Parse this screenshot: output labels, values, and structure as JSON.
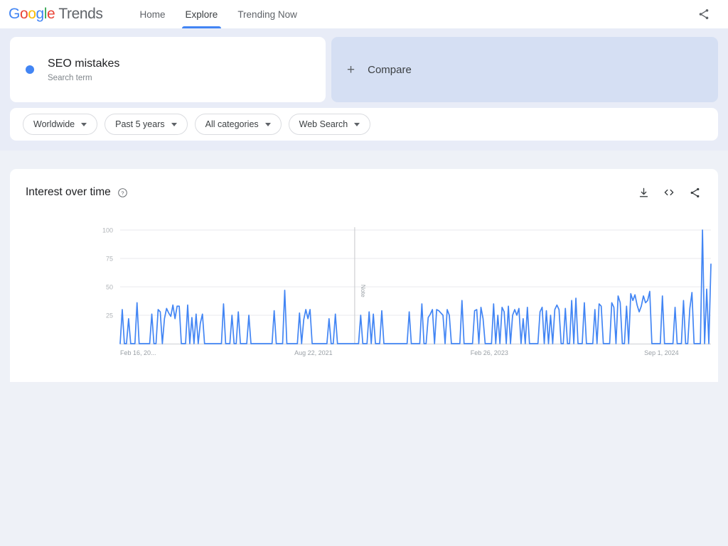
{
  "topbar": {
    "logo": {
      "google": "Google",
      "trends": "Trends"
    },
    "nav": [
      {
        "label": "Home",
        "active": false,
        "name": "nav-home"
      },
      {
        "label": "Explore",
        "active": true,
        "name": "nav-explore"
      },
      {
        "label": "Trending Now",
        "active": false,
        "name": "nav-trending-now"
      }
    ],
    "share_icon": "share-icon"
  },
  "query": {
    "term": {
      "title": "SEO mistakes",
      "subtitle": "Search term",
      "dot_color": "#4285F4"
    },
    "compare": {
      "plus": "+",
      "label": "Compare"
    }
  },
  "filters": [
    {
      "label": "Worldwide",
      "name": "filter-location"
    },
    {
      "label": "Past 5 years",
      "name": "filter-time-range"
    },
    {
      "label": "All categories",
      "name": "filter-category"
    },
    {
      "label": "Web Search",
      "name": "filter-search-type"
    }
  ],
  "chart_card": {
    "title": "Interest over time",
    "help_icon": "help-circle-icon",
    "actions": [
      {
        "name": "download-csv-button",
        "icon": "download-icon"
      },
      {
        "name": "embed-code-button",
        "icon": "code-icon"
      },
      {
        "name": "share-chart-button",
        "icon": "share-icon"
      }
    ]
  },
  "chart_data": {
    "type": "line",
    "title": "Interest over time",
    "xlabel": "",
    "ylabel": "",
    "ylim": [
      0,
      100
    ],
    "yticks": [
      25,
      50,
      75,
      100
    ],
    "ytick_labels": [
      "25",
      "50",
      "75",
      "100"
    ],
    "grid": true,
    "legend": false,
    "line_color": "#4285F4",
    "series_name": "SEO mistakes",
    "xtick_labels": [
      "Feb 16, 20...",
      "Aug 22, 2021",
      "Feb 26, 2023",
      "Sep 1, 2024"
    ],
    "xtick_positions": [
      0,
      0.295,
      0.593,
      0.887
    ],
    "annotations": [
      {
        "label": "Note",
        "x_fraction": 0.397
      }
    ],
    "values": [
      0,
      30,
      0,
      0,
      22,
      0,
      0,
      0,
      36,
      0,
      0,
      0,
      0,
      0,
      0,
      26,
      0,
      0,
      30,
      28,
      0,
      22,
      31,
      27,
      24,
      34,
      22,
      33,
      33,
      0,
      0,
      0,
      34,
      0,
      23,
      0,
      26,
      0,
      18,
      26,
      0,
      0,
      0,
      0,
      0,
      0,
      0,
      0,
      0,
      35,
      0,
      0,
      0,
      25,
      0,
      0,
      28,
      0,
      0,
      0,
      0,
      25,
      0,
      0,
      0,
      0,
      0,
      0,
      0,
      0,
      0,
      0,
      0,
      29,
      0,
      0,
      0,
      0,
      47,
      0,
      0,
      0,
      0,
      0,
      0,
      27,
      0,
      21,
      30,
      22,
      30,
      0,
      0,
      0,
      0,
      0,
      0,
      0,
      0,
      22,
      0,
      0,
      26,
      0,
      0,
      0,
      0,
      0,
      0,
      0,
      0,
      0,
      0,
      0,
      25,
      0,
      0,
      0,
      28,
      0,
      26,
      0,
      0,
      0,
      29,
      0,
      0,
      0,
      0,
      0,
      0,
      0,
      0,
      0,
      0,
      0,
      0,
      28,
      0,
      0,
      0,
      0,
      0,
      35,
      0,
      0,
      23,
      26,
      30,
      0,
      30,
      29,
      27,
      25,
      0,
      30,
      25,
      0,
      0,
      0,
      0,
      0,
      38,
      0,
      0,
      0,
      0,
      0,
      29,
      30,
      0,
      32,
      22,
      0,
      0,
      0,
      0,
      35,
      0,
      25,
      0,
      32,
      28,
      0,
      33,
      0,
      25,
      30,
      25,
      31,
      0,
      22,
      0,
      32,
      0,
      0,
      0,
      0,
      0,
      28,
      32,
      0,
      29,
      0,
      25,
      0,
      30,
      34,
      30,
      0,
      0,
      31,
      0,
      0,
      38,
      0,
      40,
      0,
      0,
      0,
      36,
      0,
      0,
      0,
      0,
      30,
      0,
      35,
      33,
      0,
      0,
      0,
      0,
      36,
      32,
      0,
      42,
      36,
      0,
      0,
      33,
      0,
      44,
      38,
      43,
      34,
      28,
      33,
      42,
      36,
      38,
      46,
      0,
      0,
      0,
      0,
      0,
      42,
      0,
      0,
      0,
      0,
      0,
      32,
      0,
      0,
      0,
      38,
      0,
      0,
      31,
      45,
      0,
      0,
      0,
      0,
      100,
      0,
      48,
      0,
      70
    ]
  }
}
